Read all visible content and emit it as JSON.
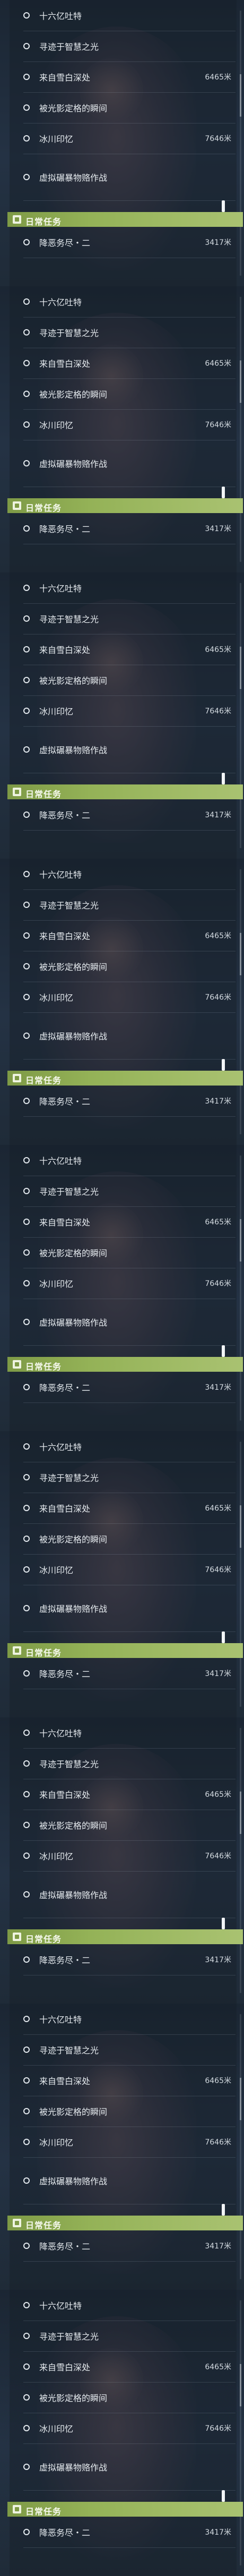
{
  "task_list": {
    "quests": [
      {
        "label": "十六亿吐特",
        "distance": ""
      },
      {
        "label": "寻迹于智慧之光",
        "distance": ""
      },
      {
        "label": "来自雪白深处",
        "distance": "6465米"
      },
      {
        "label": "被光影定格的瞬间",
        "distance": ""
      },
      {
        "label": "冰川印忆",
        "distance": "7646米"
      },
      {
        "label": "虚拟碾暴物赂作战",
        "distance": ""
      }
    ],
    "daily_header": "日常任务",
    "daily_quest": {
      "label": "降恶务尽・二",
      "distance": "3417米"
    }
  },
  "colors": {
    "header_green": "#94b257",
    "text_light": "#e6ebef",
    "background": "#1f2b38"
  },
  "icons": [
    "radio-circle-icon",
    "daily-task-icon"
  ]
}
